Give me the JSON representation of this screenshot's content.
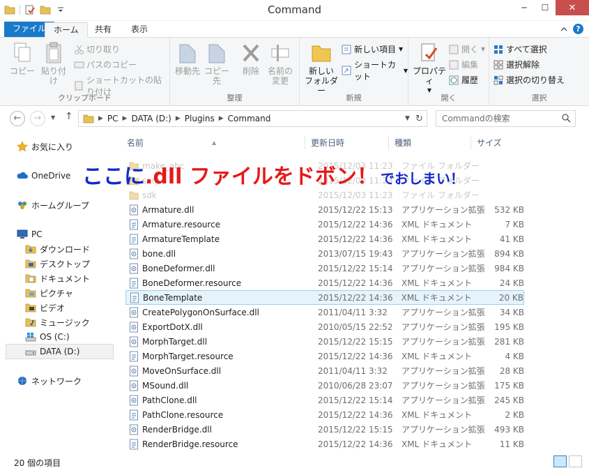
{
  "window": {
    "title": "Command",
    "minimize": "─",
    "maximize": "☐",
    "close": "✕"
  },
  "ribbon_tabs": {
    "file": "ファイル",
    "home": "ホーム",
    "share": "共有",
    "view": "表示"
  },
  "ribbon": {
    "clipboard": {
      "label": "クリップボード",
      "copy": "コピー",
      "paste": "貼り付け",
      "cut": "切り取り",
      "copy_path": "パスのコピー",
      "paste_shortcut": "ショートカットの貼り付け"
    },
    "organize": {
      "label": "整理",
      "move_to": "移動先",
      "copy_to": "コピー先",
      "delete": "削除",
      "rename_line1": "名前の",
      "rename_line2": "変更"
    },
    "new": {
      "label": "新規",
      "new_folder_line1": "新しい",
      "new_folder_line2": "フォルダー",
      "new_item": "新しい項目",
      "shortcut": "ショートカット"
    },
    "open": {
      "label": "開く",
      "properties": "プロパティ",
      "open": "開く",
      "edit": "編集",
      "history": "履歴"
    },
    "select": {
      "label": "選択",
      "select_all": "すべて選択",
      "select_none": "選択解除",
      "invert": "選択の切り替え"
    }
  },
  "address": {
    "segments": [
      "PC",
      "DATA (D:)",
      "Plugins",
      "Command"
    ],
    "search_placeholder": "Commandの検索"
  },
  "navpane": {
    "favorites": "お気に入り",
    "onedrive": "OneDrive",
    "homegroup": "ホームグループ",
    "pc": "PC",
    "downloads": "ダウンロード",
    "desktop": "デスクトップ",
    "documents": "ドキュメント",
    "pictures": "ピクチャ",
    "videos": "ビデオ",
    "music": "ミュージック",
    "os_drive": "OS (C:)",
    "data_drive": "DATA (D:)",
    "network": "ネットワーク"
  },
  "columns": {
    "name": "名前",
    "date": "更新日時",
    "type": "種類",
    "size": "サイズ"
  },
  "files": [
    {
      "name": "make_abc",
      "date": "2015/12/03 11:23",
      "type": "ファイル フォルダー",
      "size": "",
      "kind": "folder"
    },
    {
      "name": "sam",
      "date": "2015/12/03 11:23",
      "type": "ファイル フォルダー",
      "size": "",
      "kind": "folder"
    },
    {
      "name": "sdk",
      "date": "2015/12/03 11:23",
      "type": "ファイル フォルダー",
      "size": "",
      "kind": "folder"
    },
    {
      "name": "Armature.dll",
      "date": "2015/12/22 15:13",
      "type": "アプリケーション拡張",
      "size": "532 KB",
      "kind": "dll"
    },
    {
      "name": "Armature.resource",
      "date": "2015/12/22 14:36",
      "type": "XML ドキュメント",
      "size": "7 KB",
      "kind": "xml"
    },
    {
      "name": "ArmatureTemplate",
      "date": "2015/12/22 14:36",
      "type": "XML ドキュメント",
      "size": "41 KB",
      "kind": "xml"
    },
    {
      "name": "bone.dll",
      "date": "2013/07/15 19:43",
      "type": "アプリケーション拡張",
      "size": "894 KB",
      "kind": "dll"
    },
    {
      "name": "BoneDeformer.dll",
      "date": "2015/12/22 15:14",
      "type": "アプリケーション拡張",
      "size": "984 KB",
      "kind": "dll"
    },
    {
      "name": "BoneDeformer.resource",
      "date": "2015/12/22 14:36",
      "type": "XML ドキュメント",
      "size": "24 KB",
      "kind": "xml"
    },
    {
      "name": "BoneTemplate",
      "date": "2015/12/22 14:36",
      "type": "XML ドキュメント",
      "size": "20 KB",
      "kind": "xml"
    },
    {
      "name": "CreatePolygonOnSurface.dll",
      "date": "2011/04/11 3:32",
      "type": "アプリケーション拡張",
      "size": "34 KB",
      "kind": "dll"
    },
    {
      "name": "ExportDotX.dll",
      "date": "2010/05/15 22:52",
      "type": "アプリケーション拡張",
      "size": "195 KB",
      "kind": "dll"
    },
    {
      "name": "MorphTarget.dll",
      "date": "2015/12/22 15:15",
      "type": "アプリケーション拡張",
      "size": "281 KB",
      "kind": "dll"
    },
    {
      "name": "MorphTarget.resource",
      "date": "2015/12/22 14:36",
      "type": "XML ドキュメント",
      "size": "4 KB",
      "kind": "xml"
    },
    {
      "name": "MoveOnSurface.dll",
      "date": "2011/04/11 3:32",
      "type": "アプリケーション拡張",
      "size": "28 KB",
      "kind": "dll"
    },
    {
      "name": "MSound.dll",
      "date": "2010/06/28 23:07",
      "type": "アプリケーション拡張",
      "size": "175 KB",
      "kind": "dll"
    },
    {
      "name": "PathClone.dll",
      "date": "2015/12/22 15:14",
      "type": "アプリケーション拡張",
      "size": "245 KB",
      "kind": "dll"
    },
    {
      "name": "PathClone.resource",
      "date": "2015/12/22 14:36",
      "type": "XML ドキュメント",
      "size": "2 KB",
      "kind": "xml"
    },
    {
      "name": "RenderBridge.dll",
      "date": "2015/12/22 15:15",
      "type": "アプリケーション拡張",
      "size": "493 KB",
      "kind": "dll"
    },
    {
      "name": "RenderBridge.resource",
      "date": "2015/12/22 14:36",
      "type": "XML ドキュメント",
      "size": "11 KB",
      "kind": "xml"
    }
  ],
  "selected_file": "BoneTemplate",
  "overlay": {
    "part1": "ここに",
    "part2": ".dll ファイルをドボン！",
    "part3": "でおしまい！"
  },
  "status": {
    "item_count": "20 個の項目"
  }
}
